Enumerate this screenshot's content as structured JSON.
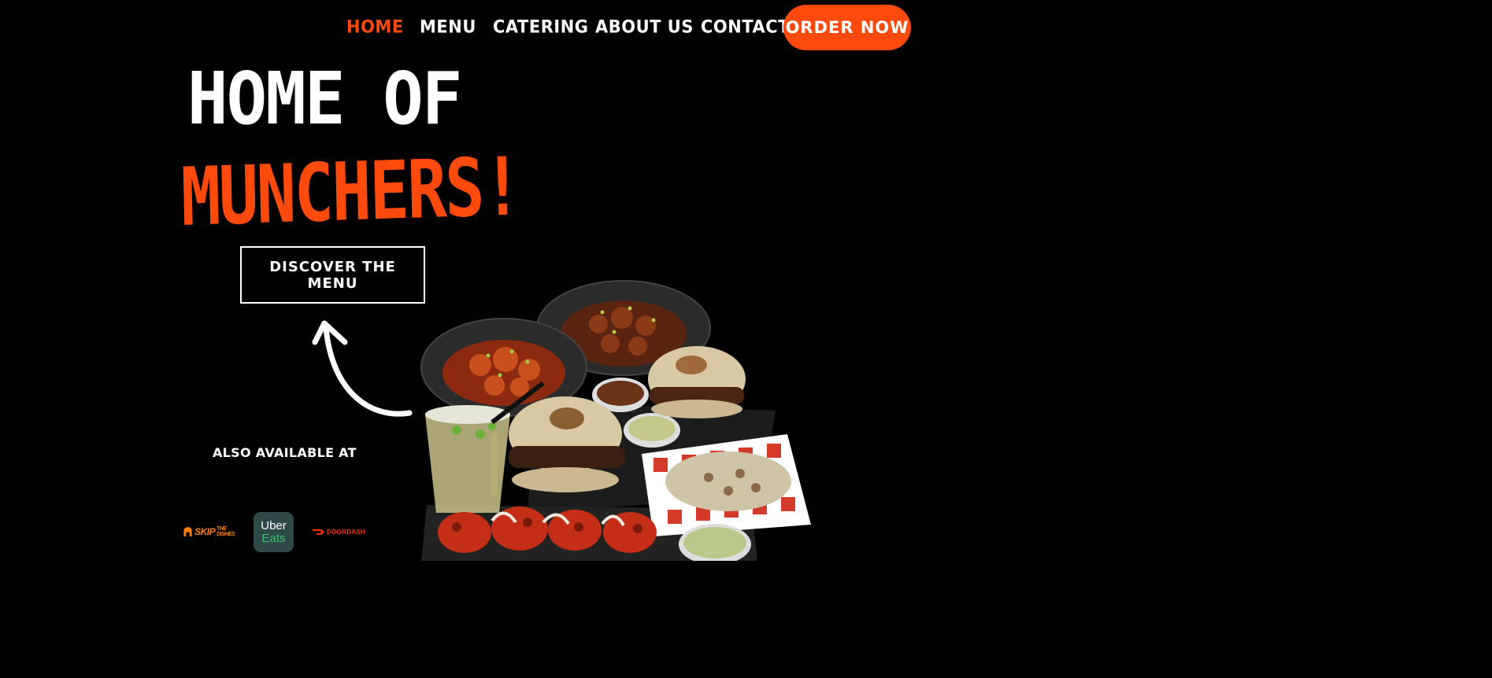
{
  "nav": {
    "items": [
      {
        "label": "HOME",
        "active": true
      },
      {
        "label": "MENU",
        "active": false
      },
      {
        "label": "CATERING",
        "active": false
      },
      {
        "label": "ABOUT US",
        "active": false
      },
      {
        "label": "CONTACT",
        "active": false
      }
    ],
    "order_label": "ORDER NOW"
  },
  "hero": {
    "line1": "HOME OF",
    "line2": "MUNCHERS!",
    "cta_label": "DISCOVER THE MENU"
  },
  "partners": {
    "label": "ALSO AVAILABLE AT",
    "skip": {
      "name": "SKIP",
      "small": "THE DISHES"
    },
    "uber": {
      "line1": "Uber",
      "line2": "Eats"
    },
    "doordash": {
      "name": "DOORDASH"
    }
  },
  "colors": {
    "accent": "#ff4a0d",
    "background": "#000000",
    "uber_bg": "#2f4949",
    "uber_green": "#3ec26e",
    "skip_orange": "#ff8000",
    "doordash_red": "#ff3008"
  },
  "icons": [
    "curved-arrow-icon",
    "skip-the-dishes-logo",
    "uber-eats-logo",
    "doordash-logo"
  ]
}
